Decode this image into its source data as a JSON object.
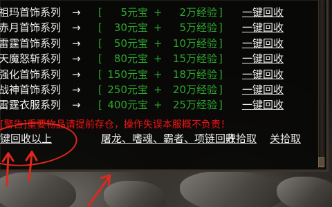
{
  "rows": [
    {
      "name": "祖玛首饰系列",
      "arrow": "→",
      "lb": "[",
      "amount": "5元宝",
      "plus": "+",
      "exp": "2万经验",
      "rb": "]",
      "action": "一键回收"
    },
    {
      "name": "赤月首饰系列",
      "arrow": "→",
      "lb": "[",
      "amount": "30元宝",
      "plus": "+",
      "exp": "5万经验",
      "rb": "]",
      "action": "一键回收"
    },
    {
      "name": "雷霆首饰系列",
      "arrow": "→",
      "lb": "[",
      "amount": "50元宝",
      "plus": "+",
      "exp": "10万经验",
      "rb": "]",
      "action": "一键回收"
    },
    {
      "name": "天魔怒斩系列",
      "arrow": "→",
      "lb": "[",
      "amount": "80元宝",
      "plus": "+",
      "exp": "15万经验",
      "rb": "]",
      "action": "一键回收"
    },
    {
      "name": "强化首饰系列",
      "arrow": "→",
      "lb": "[",
      "amount": "150元宝",
      "plus": "+",
      "exp": "18万经验",
      "rb": "]",
      "action": "一键回收"
    },
    {
      "name": "战神首饰系列",
      "arrow": "→",
      "lb": "[",
      "amount": "250元宝",
      "plus": "+",
      "exp": "20万经验",
      "rb": "]",
      "action": "一键回收"
    },
    {
      "name": "雷霆衣服系列",
      "arrow": "→",
      "lb": "[",
      "amount": "400元宝",
      "plus": "+",
      "exp": "25万经验",
      "rb": "]",
      "action": "一键回收"
    }
  ],
  "warning": "[警告]重要物品请提前存仓，操作失误本服概不负责！",
  "bottom_links": {
    "recycle_above": "键回收以上",
    "dragon_soul": "屠龙、嗜魂、霸者、项链回收",
    "pickup_on": "开拾取",
    "pickup_off": "关拾取"
  },
  "colors": {
    "text": "#f2f2f2",
    "reward_green": "#2ea82e",
    "warning_red": "#e01818",
    "annotation_red": "#e0281c"
  }
}
